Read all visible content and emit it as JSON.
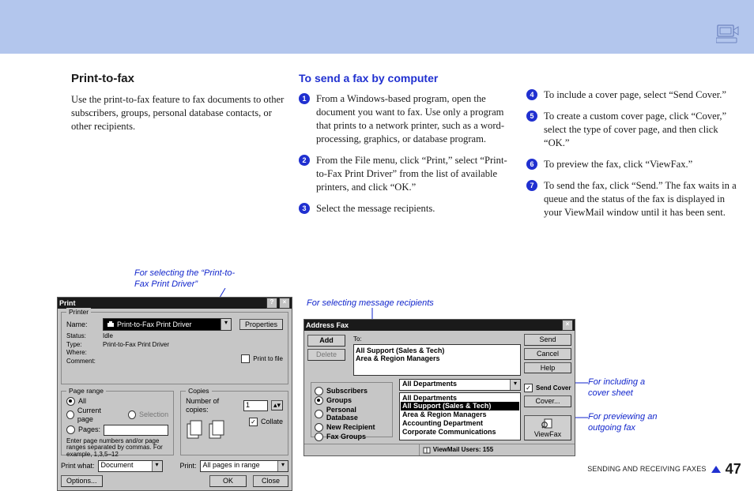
{
  "page": {
    "title": "Print-to-fax",
    "intro": "Use the print-to-fax feature to fax documents to other subscribers, groups, personal database contacts, or other recipients.",
    "section_heading": "To send a fax by computer",
    "steps": [
      "From a Windows-based program, open the document you want to fax. Use only a program that prints to a network printer, such as a word-processing, graphics, or database program.",
      "From the File menu, click “Print,” select “Print-to-Fax Print Driver” from the list of available printers, and click “OK.”",
      "Select the message recipients.",
      "To include a cover page, select “Send Cover.”",
      "To create a custom cover page, click “Cover,” select the type of cover page, and then click “OK.”",
      "To preview the fax, click “ViewFax.”",
      "To send the fax, click “Send.” The fax waits in a queue and the status of the fax is displayed in your ViewMail window until it has been sent."
    ],
    "footer_text": "SENDING AND RECEIVING FAXES",
    "page_number": "47"
  },
  "annotations": {
    "print_driver": "For selecting the “Print-to-Fax Print Driver”",
    "recipients": "For selecting message recipients",
    "cover": "For including a cover sheet",
    "preview": "For previewing an outgoing fax"
  },
  "print_dialog": {
    "title": "Print",
    "printer_group": "Printer",
    "name_label": "Name:",
    "name_value": "Print-to-Fax Print Driver",
    "properties_btn": "Properties",
    "rows": [
      {
        "label": "Status:",
        "value": "Idle"
      },
      {
        "label": "Type:",
        "value": "Print-to-Fax Print Driver"
      },
      {
        "label": "Where:",
        "value": ""
      },
      {
        "label": "Comment:",
        "value": ""
      }
    ],
    "print_to_file": "Print to file",
    "range_group": "Page range",
    "range_all": "All",
    "range_current": "Current page",
    "range_selection": "Selection",
    "range_pages": "Pages:",
    "range_hint": "Enter page numbers and/or page ranges separated by commas. For example, 1,3,5–12",
    "copies_group": "Copies",
    "copies_label": "Number of copies:",
    "copies_value": "1",
    "collate": "Collate",
    "print_what_label": "Print what:",
    "print_what_value": "Document",
    "print_label": "Print:",
    "print_value": "All pages in range",
    "options_btn": "Options...",
    "ok_btn": "OK",
    "close_btn": "Close"
  },
  "address_dialog": {
    "title": "Address Fax",
    "to_label": "To:",
    "to_lines": [
      "All Support (Sales & Tech)",
      "Area & Region Managers"
    ],
    "add_btn": "Add",
    "delete_btn": "Delete",
    "cats": [
      "Subscribers",
      "Groups",
      "Personal Database",
      "New Recipient",
      "Fax Groups"
    ],
    "cats_selected": "Groups",
    "items": [
      "All Departments",
      "All Support (Sales & Tech)",
      "Area & Region Managers",
      "Accounting Department",
      "Corporate Communications"
    ],
    "item_selected": "All Support (Sales & Tech)",
    "send_btn": "Send",
    "cancel_btn": "Cancel",
    "help_btn": "Help",
    "send_cover": "Send Cover",
    "cover_btn": "Cover...",
    "viewfax_btn": "ViewFax",
    "status": "ViewMail Users: 155"
  }
}
